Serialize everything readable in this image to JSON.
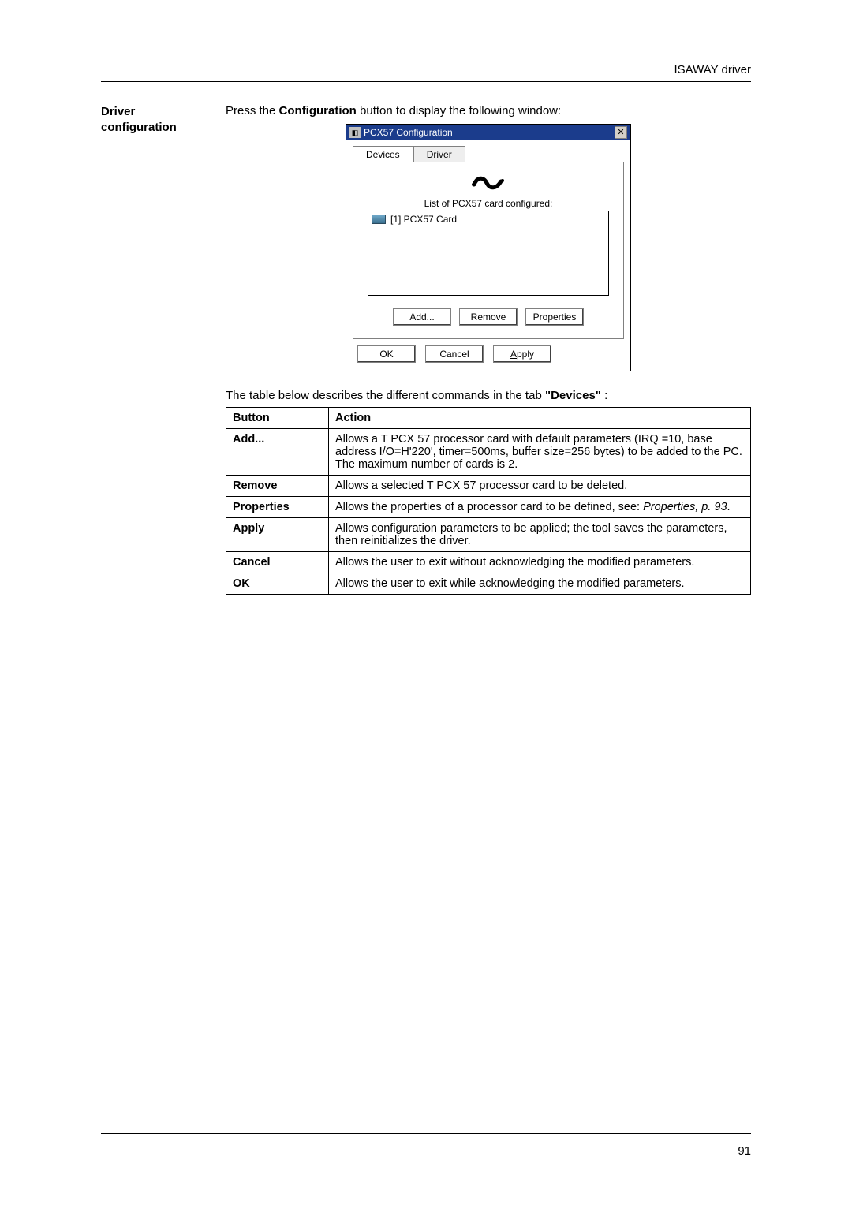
{
  "header": {
    "right": "ISAWAY driver"
  },
  "section": {
    "heading_line1": "Driver",
    "heading_line2": "configuration",
    "intro_prefix": "Press the ",
    "intro_bold": "Configuration",
    "intro_suffix": " button to display the following window:"
  },
  "dialog": {
    "title": "PCX57 Configuration",
    "tabs": {
      "devices": "Devices",
      "driver": "Driver"
    },
    "list_label": "List of PCX57 card configured:",
    "list_item": "[1] PCX57 Card",
    "buttons": {
      "add": "Add...",
      "remove": "Remove",
      "properties": "Properties"
    },
    "bottom": {
      "ok": "OK",
      "cancel": "Cancel",
      "apply_prefix": "A",
      "apply_rest": "pply"
    }
  },
  "table_intro": {
    "prefix": "The table below describes the different commands in the tab   ",
    "bold": "\"Devices\"",
    "suffix": " :"
  },
  "table": {
    "head": {
      "c1": "Button",
      "c2": "Action"
    },
    "rows": [
      {
        "button": "Add...",
        "action": "Allows a T PCX 57 processor card with default parameters (IRQ =10, base address I/O=H'220', timer=500ms, buffer size=256 bytes) to be added to the PC.\nThe maximum number of cards is 2."
      },
      {
        "button": "Remove",
        "action": "Allows a selected T PCX 57 processor card to be deleted."
      },
      {
        "button": "Properties",
        "action_plain": "Allows the properties of a processor card to be defined, see: ",
        "action_italic": "Properties, p. 93",
        "action_after": "."
      },
      {
        "button": "Apply",
        "action": "Allows configuration parameters to be applied; the tool saves the parameters, then reinitializes the driver."
      },
      {
        "button": "Cancel",
        "action": "Allows the user to exit without acknowledging the modified parameters."
      },
      {
        "button": "OK",
        "action": "Allows the user to exit while acknowledging the modified parameters."
      }
    ]
  },
  "page_number": "91"
}
